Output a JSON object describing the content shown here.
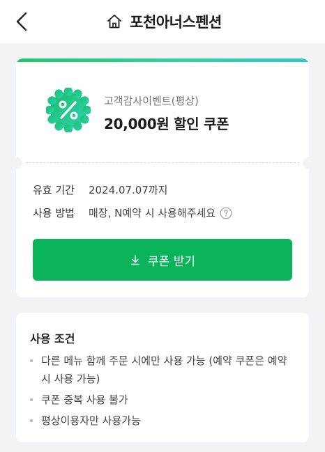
{
  "header": {
    "title": "포천아너스펜션",
    "back_icon": "chevron-left-icon",
    "home_icon": "home-icon"
  },
  "coupon": {
    "source": "고객감사이벤트(평상)",
    "name": "20,000원 할인 쿠폰",
    "badge_icon": "percent-badge-icon",
    "validity_label": "유효 기간",
    "validity_value": "2024.07.07까지",
    "usage_label": "사용 방법",
    "usage_value": "매장, N예약 시 사용해주세요",
    "download_label": "쿠폰 받기",
    "accent_color": "#0bb35a"
  },
  "conditions": {
    "title": "사용 조건",
    "items": [
      "다른 메뉴 함께 주문 시에만 사용 가능 (예약 쿠폰은 예약시 사용 가능)",
      "쿠폰 중복 사용 불가",
      "평상이용자만 사용가능"
    ]
  }
}
